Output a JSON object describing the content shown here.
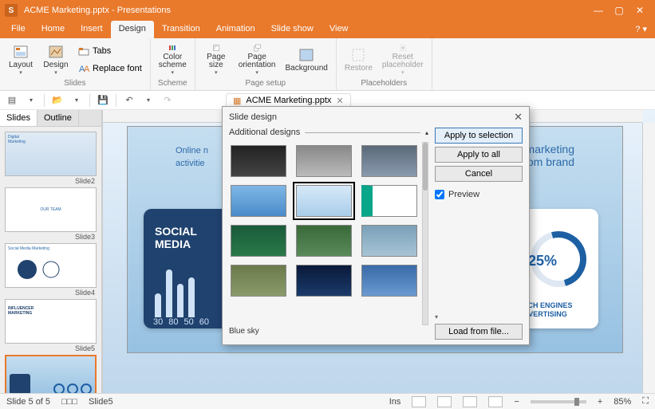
{
  "titlebar": {
    "title": "ACME Marketing.pptx - Presentations"
  },
  "menu": {
    "file": "File",
    "home": "Home",
    "insert": "Insert",
    "design": "Design",
    "transition": "Transition",
    "animation": "Animation",
    "slideshow": "Slide show",
    "view": "View"
  },
  "ribbon": {
    "slides": {
      "layout": "Layout",
      "design": "Design",
      "tabs": "Tabs",
      "replace_font": "Replace font",
      "group": "Slides"
    },
    "scheme": {
      "color_scheme": "Color\nscheme",
      "group": "Scheme"
    },
    "page": {
      "page_size": "Page\nsize",
      "page_orientation": "Page\norientation",
      "background": "Background",
      "group": "Page setup"
    },
    "placeholders": {
      "restore": "Restore",
      "reset": "Reset\nplaceholder",
      "group": "Placeholders"
    }
  },
  "doc_tab": {
    "name": "ACME Marketing.pptx"
  },
  "panel_tabs": {
    "slides": "Slides",
    "outline": "Outline"
  },
  "thumbs": [
    {
      "label": "Slide2"
    },
    {
      "label": "Slide3"
    },
    {
      "label": "Slide4"
    },
    {
      "label": "Slide5"
    }
  ],
  "slide": {
    "subtitle_left": "Online n",
    "subtitle_right": "l marketing\nrom brand",
    "subtitle_mid": "activitie",
    "card_blue_title": "SOCIAL\nMEDIA",
    "card_blue_nums": [
      "30",
      "80",
      "50",
      "60"
    ],
    "card_right_pct": "25%",
    "card_right_caption": "EARCH ENGINES\nADVERTISING"
  },
  "dialog": {
    "title": "Slide design",
    "additional": "Additional designs",
    "apply_selection": "Apply to selection",
    "apply_all": "Apply to all",
    "cancel": "Cancel",
    "preview": "Preview",
    "load": "Load from file...",
    "selected_name": "Blue sky",
    "designs": [
      "dark",
      "gray",
      "bluegray",
      "skyblue",
      "bluesky",
      "cyan",
      "teal",
      "green",
      "steel",
      "olive",
      "navy",
      "lightblue"
    ]
  },
  "status": {
    "slide_of": "Slide 5 of 5",
    "slide_name": "Slide5",
    "ins": "Ins",
    "zoom": "85%"
  }
}
